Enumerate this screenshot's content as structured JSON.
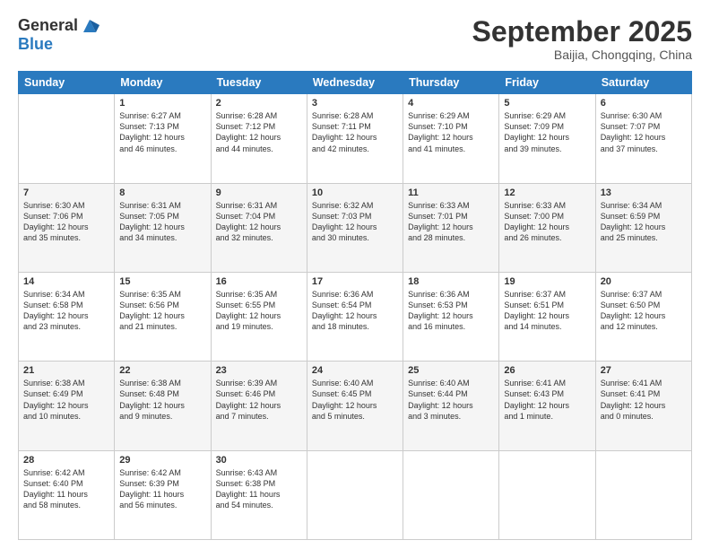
{
  "logo": {
    "line1": "General",
    "line2": "Blue"
  },
  "header": {
    "month": "September 2025",
    "location": "Baijia, Chongqing, China"
  },
  "weekdays": [
    "Sunday",
    "Monday",
    "Tuesday",
    "Wednesday",
    "Thursday",
    "Friday",
    "Saturday"
  ],
  "weeks": [
    [
      {
        "day": "",
        "info": ""
      },
      {
        "day": "1",
        "info": "Sunrise: 6:27 AM\nSunset: 7:13 PM\nDaylight: 12 hours\nand 46 minutes."
      },
      {
        "day": "2",
        "info": "Sunrise: 6:28 AM\nSunset: 7:12 PM\nDaylight: 12 hours\nand 44 minutes."
      },
      {
        "day": "3",
        "info": "Sunrise: 6:28 AM\nSunset: 7:11 PM\nDaylight: 12 hours\nand 42 minutes."
      },
      {
        "day": "4",
        "info": "Sunrise: 6:29 AM\nSunset: 7:10 PM\nDaylight: 12 hours\nand 41 minutes."
      },
      {
        "day": "5",
        "info": "Sunrise: 6:29 AM\nSunset: 7:09 PM\nDaylight: 12 hours\nand 39 minutes."
      },
      {
        "day": "6",
        "info": "Sunrise: 6:30 AM\nSunset: 7:07 PM\nDaylight: 12 hours\nand 37 minutes."
      }
    ],
    [
      {
        "day": "7",
        "info": "Sunrise: 6:30 AM\nSunset: 7:06 PM\nDaylight: 12 hours\nand 35 minutes."
      },
      {
        "day": "8",
        "info": "Sunrise: 6:31 AM\nSunset: 7:05 PM\nDaylight: 12 hours\nand 34 minutes."
      },
      {
        "day": "9",
        "info": "Sunrise: 6:31 AM\nSunset: 7:04 PM\nDaylight: 12 hours\nand 32 minutes."
      },
      {
        "day": "10",
        "info": "Sunrise: 6:32 AM\nSunset: 7:03 PM\nDaylight: 12 hours\nand 30 minutes."
      },
      {
        "day": "11",
        "info": "Sunrise: 6:33 AM\nSunset: 7:01 PM\nDaylight: 12 hours\nand 28 minutes."
      },
      {
        "day": "12",
        "info": "Sunrise: 6:33 AM\nSunset: 7:00 PM\nDaylight: 12 hours\nand 26 minutes."
      },
      {
        "day": "13",
        "info": "Sunrise: 6:34 AM\nSunset: 6:59 PM\nDaylight: 12 hours\nand 25 minutes."
      }
    ],
    [
      {
        "day": "14",
        "info": "Sunrise: 6:34 AM\nSunset: 6:58 PM\nDaylight: 12 hours\nand 23 minutes."
      },
      {
        "day": "15",
        "info": "Sunrise: 6:35 AM\nSunset: 6:56 PM\nDaylight: 12 hours\nand 21 minutes."
      },
      {
        "day": "16",
        "info": "Sunrise: 6:35 AM\nSunset: 6:55 PM\nDaylight: 12 hours\nand 19 minutes."
      },
      {
        "day": "17",
        "info": "Sunrise: 6:36 AM\nSunset: 6:54 PM\nDaylight: 12 hours\nand 18 minutes."
      },
      {
        "day": "18",
        "info": "Sunrise: 6:36 AM\nSunset: 6:53 PM\nDaylight: 12 hours\nand 16 minutes."
      },
      {
        "day": "19",
        "info": "Sunrise: 6:37 AM\nSunset: 6:51 PM\nDaylight: 12 hours\nand 14 minutes."
      },
      {
        "day": "20",
        "info": "Sunrise: 6:37 AM\nSunset: 6:50 PM\nDaylight: 12 hours\nand 12 minutes."
      }
    ],
    [
      {
        "day": "21",
        "info": "Sunrise: 6:38 AM\nSunset: 6:49 PM\nDaylight: 12 hours\nand 10 minutes."
      },
      {
        "day": "22",
        "info": "Sunrise: 6:38 AM\nSunset: 6:48 PM\nDaylight: 12 hours\nand 9 minutes."
      },
      {
        "day": "23",
        "info": "Sunrise: 6:39 AM\nSunset: 6:46 PM\nDaylight: 12 hours\nand 7 minutes."
      },
      {
        "day": "24",
        "info": "Sunrise: 6:40 AM\nSunset: 6:45 PM\nDaylight: 12 hours\nand 5 minutes."
      },
      {
        "day": "25",
        "info": "Sunrise: 6:40 AM\nSunset: 6:44 PM\nDaylight: 12 hours\nand 3 minutes."
      },
      {
        "day": "26",
        "info": "Sunrise: 6:41 AM\nSunset: 6:43 PM\nDaylight: 12 hours\nand 1 minute."
      },
      {
        "day": "27",
        "info": "Sunrise: 6:41 AM\nSunset: 6:41 PM\nDaylight: 12 hours\nand 0 minutes."
      }
    ],
    [
      {
        "day": "28",
        "info": "Sunrise: 6:42 AM\nSunset: 6:40 PM\nDaylight: 11 hours\nand 58 minutes."
      },
      {
        "day": "29",
        "info": "Sunrise: 6:42 AM\nSunset: 6:39 PM\nDaylight: 11 hours\nand 56 minutes."
      },
      {
        "day": "30",
        "info": "Sunrise: 6:43 AM\nSunset: 6:38 PM\nDaylight: 11 hours\nand 54 minutes."
      },
      {
        "day": "",
        "info": ""
      },
      {
        "day": "",
        "info": ""
      },
      {
        "day": "",
        "info": ""
      },
      {
        "day": "",
        "info": ""
      }
    ]
  ]
}
